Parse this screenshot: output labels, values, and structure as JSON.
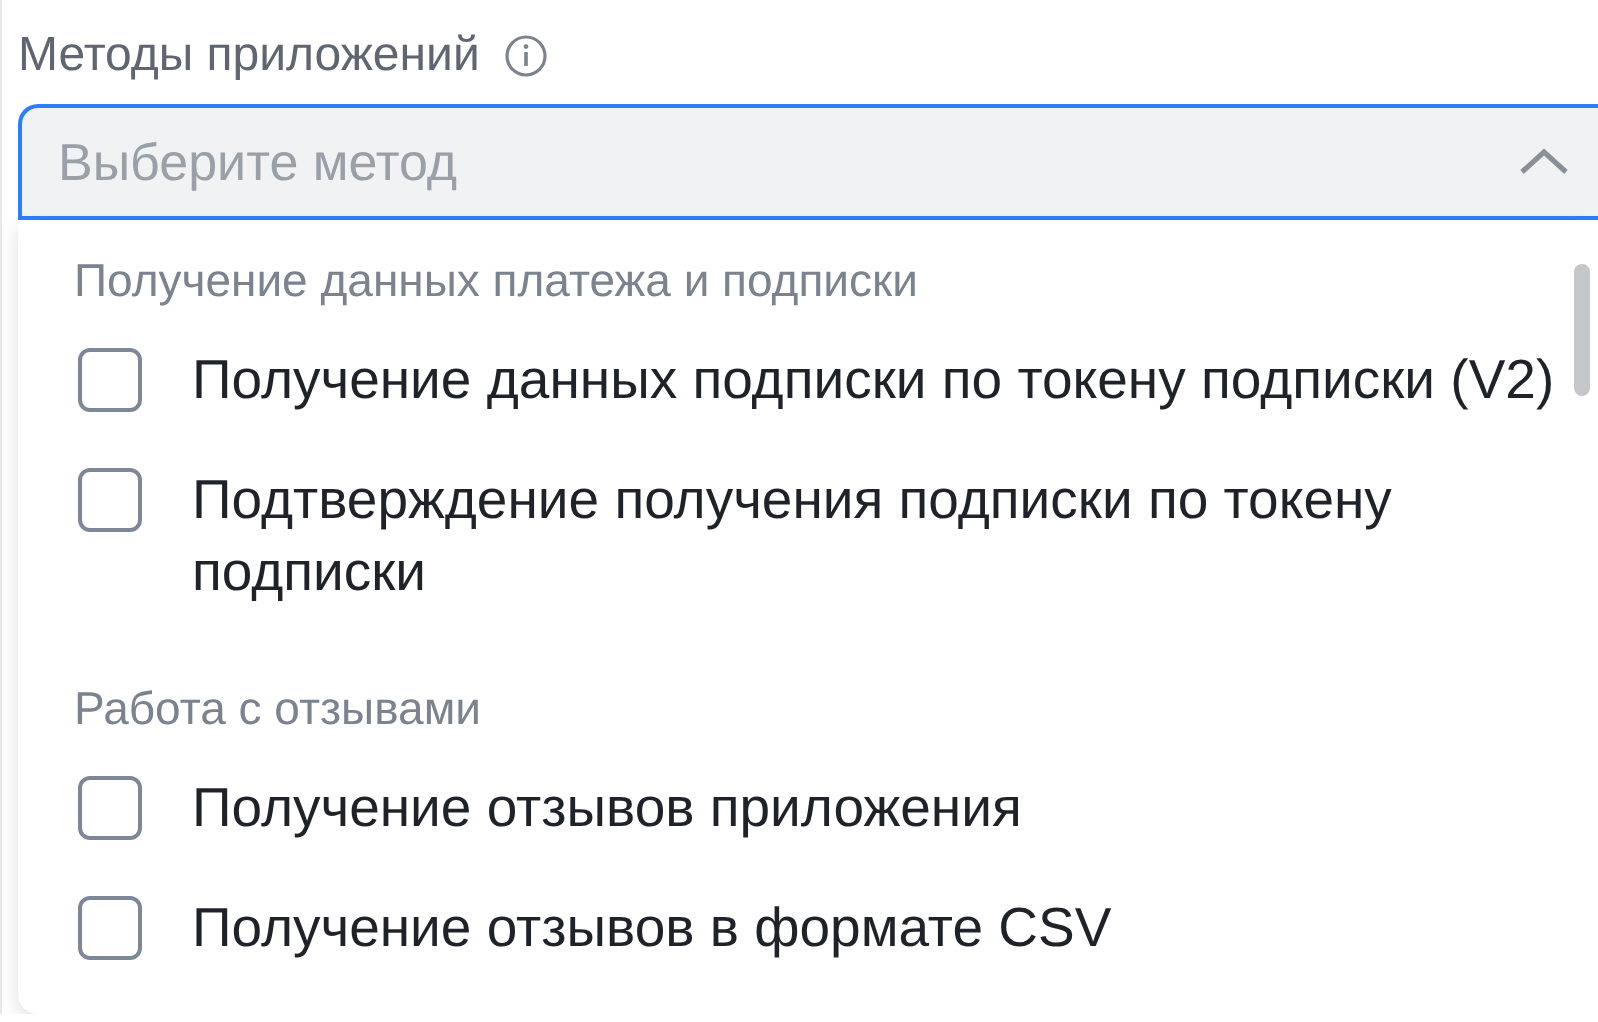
{
  "field": {
    "label": "Методы приложений",
    "placeholder": "Выберите метод",
    "expanded": true
  },
  "groups": [
    {
      "title": "Получение данных платежа и подписки",
      "items": [
        {
          "label": "Получение данных подписки по токену подписки (V2)",
          "checked": false
        },
        {
          "label": "Подтверждение получения подписки по токену подписки",
          "checked": false
        }
      ]
    },
    {
      "title": "Работа с отзывами",
      "items": [
        {
          "label": "Получение отзывов приложения",
          "checked": false
        },
        {
          "label": "Получение отзывов в формате CSV",
          "checked": false
        }
      ]
    }
  ]
}
